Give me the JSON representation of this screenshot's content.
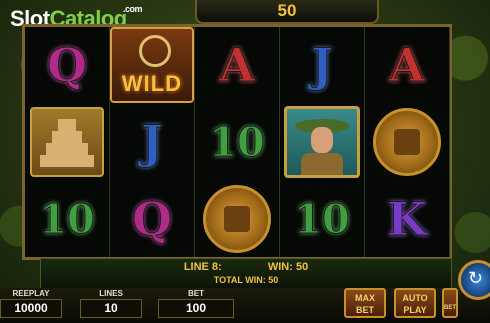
{
  "logo": {
    "slot": "Slot",
    "catalog": "Catalog",
    "com": ".com"
  },
  "header": {
    "win_amount": "50"
  },
  "reels": [
    [
      {
        "type": "letter",
        "text": "Q",
        "cls": "q"
      },
      {
        "type": "temple"
      },
      {
        "type": "letter",
        "text": "10",
        "cls": "ten"
      }
    ],
    [
      {
        "type": "wild",
        "text": "WILD"
      },
      {
        "type": "letter",
        "text": "J",
        "cls": "j"
      },
      {
        "type": "letter",
        "text": "Q",
        "cls": "q"
      }
    ],
    [
      {
        "type": "letter",
        "text": "A",
        "cls": "a"
      },
      {
        "type": "letter",
        "text": "10",
        "cls": "ten"
      },
      {
        "type": "coin"
      }
    ],
    [
      {
        "type": "letter",
        "text": "J",
        "cls": "j"
      },
      {
        "type": "explorer"
      },
      {
        "type": "letter",
        "text": "10",
        "cls": "ten"
      }
    ],
    [
      {
        "type": "letter",
        "text": "A",
        "cls": "a"
      },
      {
        "type": "coin"
      },
      {
        "type": "letter",
        "text": "K",
        "cls": "k"
      }
    ]
  ],
  "win": {
    "line_label": "LINE 8:",
    "win_label": "WIN: 50",
    "total": "TOTAL WIN: 50"
  },
  "controls": {
    "freeplay_label": "REEPLAY",
    "freeplay_value": "10000",
    "lines_label": "LINES",
    "lines_value": "10",
    "bet_label": "BET",
    "bet_value": "100",
    "max_bet": [
      "MAX",
      "BET"
    ],
    "auto_play": [
      "AUTO",
      "PLAY"
    ],
    "bet_small": "BET"
  }
}
